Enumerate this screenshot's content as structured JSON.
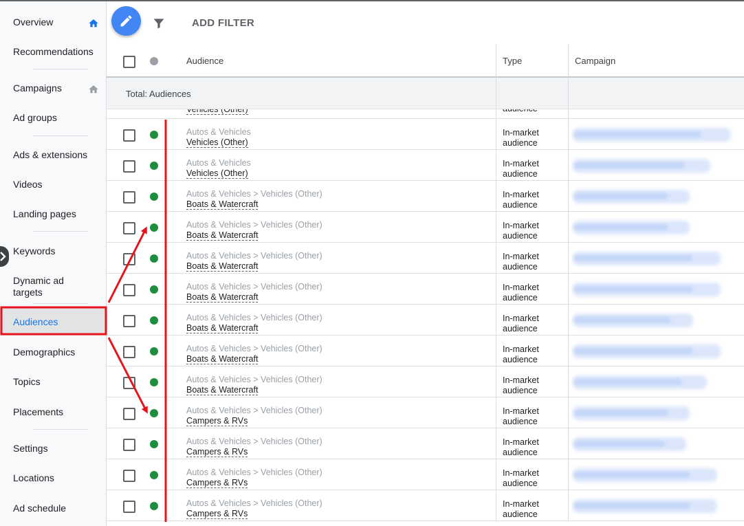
{
  "sidebar": {
    "items": [
      {
        "label": "Overview",
        "home": true
      },
      {
        "label": "Recommendations"
      },
      {
        "label": "Campaigns",
        "home": true
      },
      {
        "label": "Ad groups"
      },
      {
        "label": "Ads & extensions"
      },
      {
        "label": "Videos"
      },
      {
        "label": "Landing pages"
      },
      {
        "label": "Keywords"
      },
      {
        "label": "Dynamic ad targets"
      },
      {
        "label": "Audiences",
        "active": true
      },
      {
        "label": "Demographics"
      },
      {
        "label": "Topics"
      },
      {
        "label": "Placements"
      },
      {
        "label": "Settings"
      },
      {
        "label": "Locations"
      },
      {
        "label": "Ad schedule"
      }
    ]
  },
  "toolbar": {
    "add_filter": "ADD FILTER",
    "edit_icon": "pencil-icon",
    "filter_icon": "funnel-icon"
  },
  "table": {
    "columns": {
      "audience": "Audience",
      "type": "Type",
      "campaign": "Campaign"
    },
    "total_label": "Total: Audiences",
    "cut_row": {
      "audience": "Vehicles (Other)",
      "type": "audience"
    },
    "rows": [
      {
        "category": "Autos & Vehicles",
        "audience": "Vehicles (Other)",
        "type_line1": "In-market",
        "type_line2": "audience"
      },
      {
        "category": "Autos & Vehicles",
        "audience": "Vehicles (Other)",
        "type_line1": "In-market",
        "type_line2": "audience"
      },
      {
        "category": "Autos & Vehicles > Vehicles (Other)",
        "audience": "Boats & Watercraft",
        "type_line1": "In-market",
        "type_line2": "audience"
      },
      {
        "category": "Autos & Vehicles > Vehicles (Other)",
        "audience": "Boats & Watercraft",
        "type_line1": "In-market",
        "type_line2": "audience"
      },
      {
        "category": "Autos & Vehicles > Vehicles (Other)",
        "audience": "Boats & Watercraft",
        "type_line1": "In-market",
        "type_line2": "audience"
      },
      {
        "category": "Autos & Vehicles > Vehicles (Other)",
        "audience": "Boats & Watercraft",
        "type_line1": "In-market",
        "type_line2": "audience"
      },
      {
        "category": "Autos & Vehicles > Vehicles (Other)",
        "audience": "Boats & Watercraft",
        "type_line1": "In-market",
        "type_line2": "audience"
      },
      {
        "category": "Autos & Vehicles > Vehicles (Other)",
        "audience": "Boats & Watercraft",
        "type_line1": "In-market",
        "type_line2": "audience"
      },
      {
        "category": "Autos & Vehicles > Vehicles (Other)",
        "audience": "Boats & Watercraft",
        "type_line1": "In-market",
        "type_line2": "audience"
      },
      {
        "category": "Autos & Vehicles > Vehicles (Other)",
        "audience": "Campers & RVs",
        "type_line1": "In-market",
        "type_line2": "audience"
      },
      {
        "category": "Autos & Vehicles > Vehicles (Other)",
        "audience": "Campers & RVs",
        "type_line1": "In-market",
        "type_line2": "audience"
      },
      {
        "category": "Autos & Vehicles > Vehicles (Other)",
        "audience": "Campers & RVs",
        "type_line1": "In-market",
        "type_line2": "audience"
      },
      {
        "category": "Autos & Vehicles > Vehicles (Other)",
        "audience": "Campers & RVs",
        "type_line1": "In-market",
        "type_line2": "audience"
      }
    ]
  },
  "colors": {
    "accent": "#1a73e8",
    "fab": "#4285f4",
    "status_enabled": "#1e8e3e",
    "status_header": "#9aa0a6",
    "annotation": "#e8131b"
  }
}
